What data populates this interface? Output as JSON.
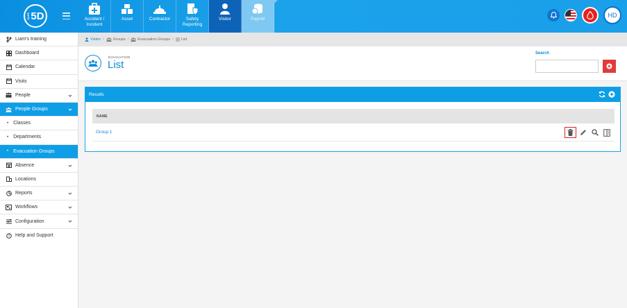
{
  "topbar": {
    "logo_text": "5D",
    "logo_small": "SAFE",
    "modules": [
      {
        "label": "Accident / Incident",
        "icon": "first-aid-kit-icon",
        "state": "normal"
      },
      {
        "label": "Asset",
        "icon": "boxes-icon",
        "state": "normal"
      },
      {
        "label": "Contractor",
        "icon": "hard-hat-icon",
        "state": "normal"
      },
      {
        "label": "Safety Reporting",
        "icon": "report-shield-icon",
        "state": "normal"
      },
      {
        "label": "Visitor",
        "icon": "person-icon",
        "state": "active"
      },
      {
        "label": "Payroll",
        "icon": "coins-icon",
        "state": "ghost"
      }
    ],
    "avatar_initials": "HD",
    "icons": [
      "bell-icon",
      "us-flag-icon",
      "drop-icon",
      "avatar"
    ]
  },
  "sidebar": {
    "items": [
      {
        "label": "Liam's training",
        "icon": "branch-icon",
        "chevron": false,
        "active": false,
        "sub": false
      },
      {
        "label": "Dashboard",
        "icon": "dashboard-icon",
        "chevron": false,
        "active": false,
        "sub": false
      },
      {
        "label": "Calendar",
        "icon": "calendar-icon",
        "chevron": false,
        "active": false,
        "sub": false
      },
      {
        "label": "Visits",
        "icon": "calendar-icon",
        "chevron": false,
        "active": false,
        "sub": false
      },
      {
        "label": "People",
        "icon": "people-icon",
        "chevron": true,
        "active": false,
        "sub": false
      },
      {
        "label": "People Groups",
        "icon": "people-group-icon",
        "chevron": true,
        "active": true,
        "sub": false
      },
      {
        "label": "Classes",
        "icon": "",
        "chevron": false,
        "active": false,
        "sub": true
      },
      {
        "label": "Departments",
        "icon": "",
        "chevron": false,
        "active": false,
        "sub": true
      },
      {
        "label": "Evacuation Groups",
        "icon": "",
        "chevron": false,
        "active": true,
        "sub": true
      },
      {
        "label": "Absence",
        "icon": "calendar-x-icon",
        "chevron": true,
        "active": false,
        "sub": false
      },
      {
        "label": "Locations",
        "icon": "building-icon",
        "chevron": false,
        "active": false,
        "sub": false
      },
      {
        "label": "Reports",
        "icon": "pie-chart-icon",
        "chevron": true,
        "active": false,
        "sub": false
      },
      {
        "label": "Workflows",
        "icon": "workflow-icon",
        "chevron": true,
        "active": false,
        "sub": false
      },
      {
        "label": "Configuration",
        "icon": "sliders-icon",
        "chevron": true,
        "active": false,
        "sub": false
      },
      {
        "label": "Help and Support",
        "icon": "help-icon",
        "chevron": false,
        "active": false,
        "sub": false
      }
    ]
  },
  "breadcrumb": {
    "items": [
      "Visitor",
      "Groups",
      "Evacuation Groups",
      "List"
    ]
  },
  "header": {
    "subtitle": "EVACUATION",
    "title": "List",
    "search_label": "Search",
    "search_value": ""
  },
  "results": {
    "title": "Results",
    "column_header": "NAME",
    "rows": [
      {
        "name": "Group 1"
      }
    ]
  },
  "colors": {
    "brand_blue": "#0d9ee6",
    "link_blue": "#0d8bd8",
    "danger_red": "#e23b3b"
  }
}
